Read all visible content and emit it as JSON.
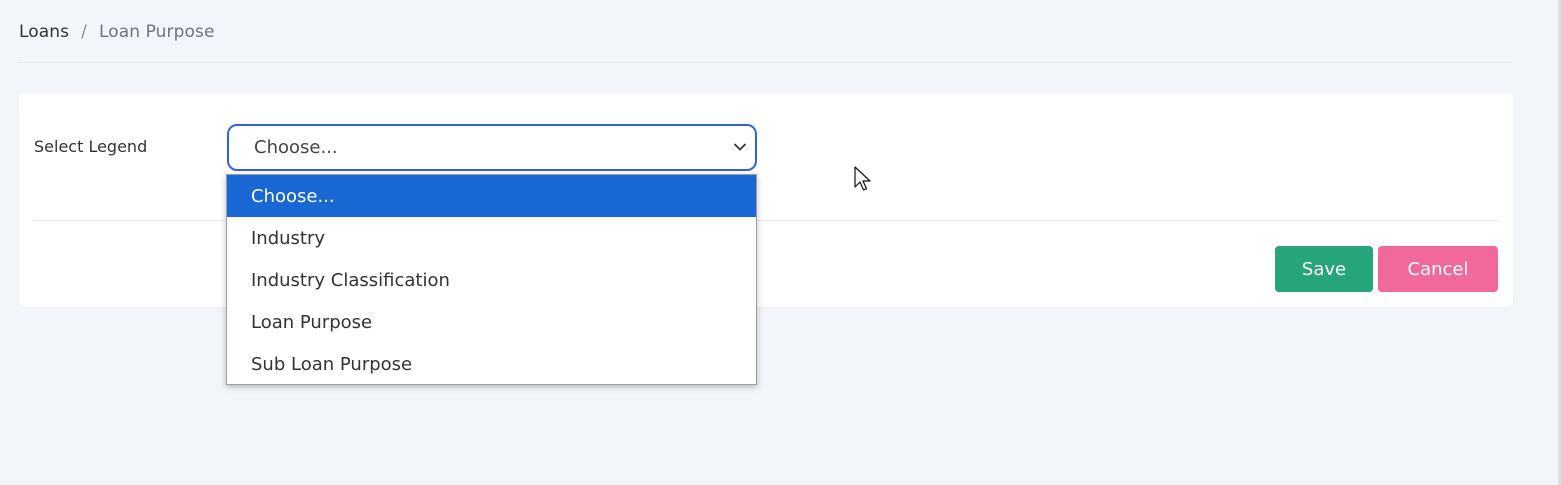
{
  "breadcrumb": {
    "root": "Loans",
    "separator": "/",
    "current": "Loan Purpose"
  },
  "form": {
    "legend_label": "Select Legend",
    "select": {
      "selected": "Choose...",
      "options": [
        "Choose...",
        "Industry",
        "Industry Classification",
        "Loan Purpose",
        "Sub Loan Purpose"
      ],
      "expanded": true
    }
  },
  "actions": {
    "save_label": "Save",
    "cancel_label": "Cancel"
  },
  "colors": {
    "page_background": "#f2f5f9",
    "select_focus_border": "#2f64dc",
    "option_highlight": "#1967d2",
    "save_button": "#27a57a",
    "cancel_button": "#f1699a"
  },
  "icons": {
    "select_arrow": "chevron-down-icon",
    "pointer": "mouse-cursor-icon"
  }
}
